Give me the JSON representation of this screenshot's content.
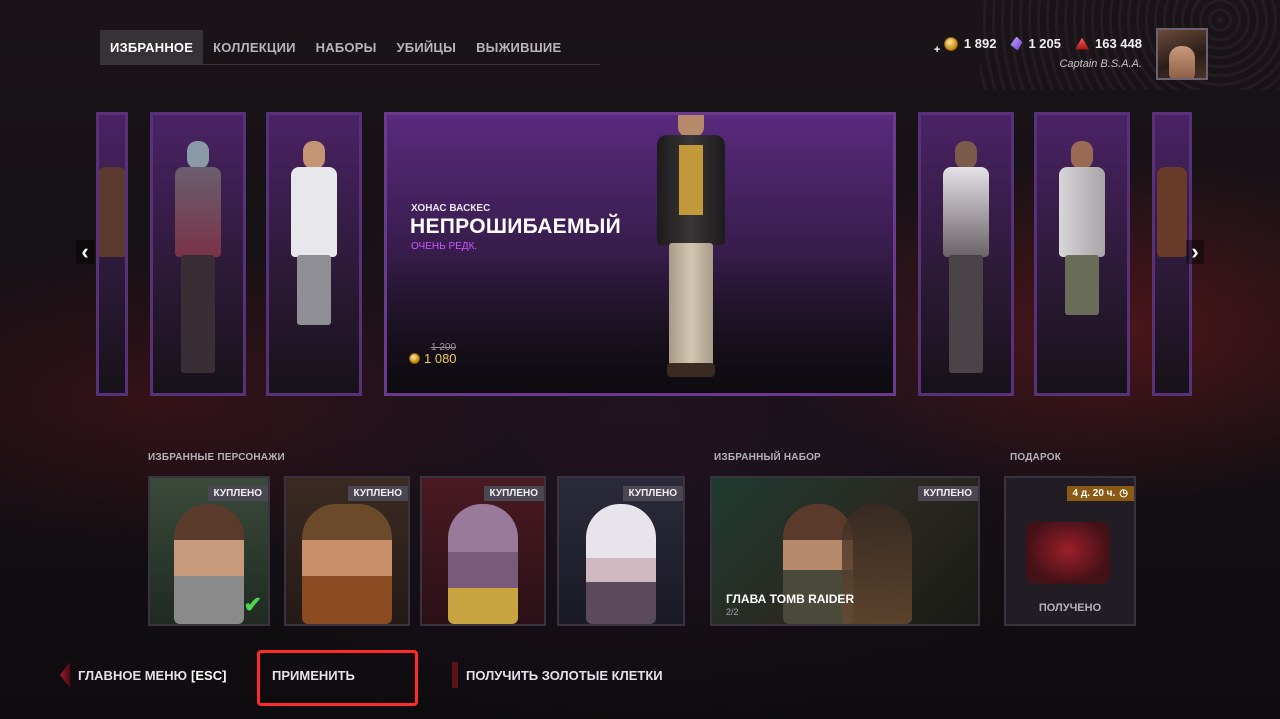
{
  "nav": {
    "tabs": [
      {
        "label": "ИЗБРАННОЕ",
        "active": true
      },
      {
        "label": "КОЛЛЕКЦИИ",
        "active": false
      },
      {
        "label": "НАБОРЫ",
        "active": false
      },
      {
        "label": "УБИЙЦЫ",
        "active": false
      },
      {
        "label": "ВЫЖИВШИЕ",
        "active": false
      }
    ]
  },
  "currencies": {
    "auric_cells": "1 892",
    "iridescent_shards": "1 205",
    "bloodpoints": "163 448"
  },
  "profile": {
    "username": "Captain B.S.A.A."
  },
  "featured": {
    "character": "ХОНАС ВАСКЕС",
    "title": "НЕПРОШИБАЕМЫЙ",
    "rarity": "ОЧЕНЬ РЕДК.",
    "old_price": "1 200",
    "price": "1 080",
    "colors": {
      "rarity": "#c659ff",
      "price": "#f0c860",
      "card_border": "#6a3a8e"
    }
  },
  "sections": {
    "characters_title": "ИЗБРАННЫЕ ПЕРСОНАЖИ",
    "bundle_title": "ИЗБРАННЫЙ НАБОР",
    "gift_title": "ПОДАРОК"
  },
  "characters": [
    {
      "badge": "КУПЛЕНО",
      "selected": true
    },
    {
      "badge": "КУПЛЕНО",
      "selected": false
    },
    {
      "badge": "КУПЛЕНО",
      "selected": false
    },
    {
      "badge": "КУПЛЕНО",
      "selected": false
    }
  ],
  "bundle": {
    "badge": "КУПЛЕНО",
    "name": "ГЛАВА TOMB RAIDER",
    "count": "2/2"
  },
  "gift": {
    "timer": "4 д. 20 ч.",
    "status": "ПОЛУЧЕНО"
  },
  "bottom": {
    "main_menu": "ГЛАВНОЕ МЕНЮ",
    "main_menu_key": "[ESC]",
    "apply": "ПРИМЕНИТЬ",
    "get_auric": "ПОЛУЧИТЬ ЗОЛОТЫЕ КЛЕТКИ"
  },
  "icons": {
    "prev": "‹",
    "next": "›",
    "check": "✔",
    "clock": "◷",
    "plus": "+"
  }
}
